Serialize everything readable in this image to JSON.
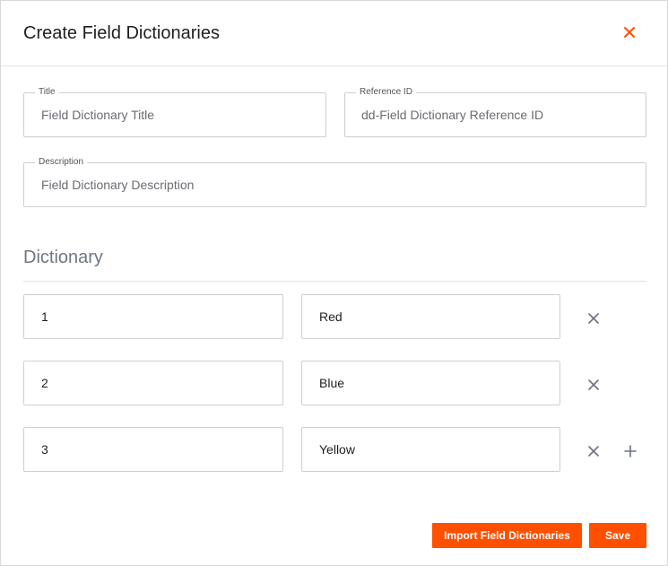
{
  "dialog": {
    "title": "Create Field Dictionaries",
    "close_icon": "close-icon",
    "accent_color": "#ff4f00"
  },
  "form": {
    "title_field": {
      "label": "Title",
      "placeholder": "Field Dictionary Title"
    },
    "reference_field": {
      "label": "Reference ID",
      "placeholder": "dd-Field Dictionary Reference ID"
    },
    "description_field": {
      "label": "Description",
      "placeholder": "Field Dictionary Description"
    }
  },
  "dictionary": {
    "heading": "Dictionary",
    "rows": [
      {
        "key": "1",
        "value": "Red"
      },
      {
        "key": "2",
        "value": "Blue"
      },
      {
        "key": "3",
        "value": "Yellow"
      }
    ],
    "remove_icon": "remove-icon",
    "add_icon": "plus-icon"
  },
  "footer": {
    "import_label": "Import Field Dictionaries",
    "save_label": "Save"
  }
}
